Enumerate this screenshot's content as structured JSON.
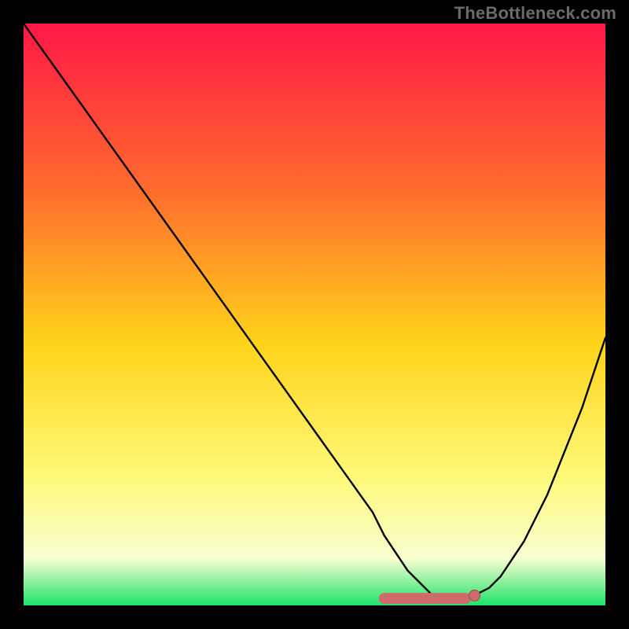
{
  "watermark": "TheBottleneck.com",
  "colors": {
    "gradient_top": "#ff1846",
    "gradient_mid_upper": "#ff6a2e",
    "gradient_mid": "#ffd31a",
    "gradient_lower": "#fff97a",
    "gradient_valley": "#f7ffd0",
    "gradient_bottom": "#1fe26a",
    "curve": "#000000",
    "marker": "#cf6b6a",
    "marker_stroke": "#9c4a49"
  },
  "chart_data": {
    "type": "line",
    "title": "",
    "xlabel": "",
    "ylabel": "",
    "xlim": [
      0,
      100
    ],
    "ylim": [
      0,
      100
    ],
    "grid": false,
    "series": [
      {
        "name": "bottleneck-curve",
        "x": [
          0,
          5,
          10,
          15,
          20,
          25,
          30,
          35,
          40,
          45,
          50,
          55,
          60,
          62,
          64,
          66,
          68,
          70,
          72,
          74,
          76,
          78,
          80,
          82,
          84,
          86,
          88,
          90,
          92,
          94,
          96,
          98,
          100
        ],
        "values": [
          100,
          93,
          86,
          79,
          72,
          65,
          58,
          51,
          44,
          37,
          30,
          23,
          16,
          12,
          9,
          6,
          4,
          2,
          1,
          1,
          1,
          2,
          3,
          5,
          8,
          11,
          15,
          19,
          24,
          29,
          34,
          40,
          46
        ]
      }
    ],
    "markers": [
      {
        "name": "optimal-range",
        "type": "segment",
        "x": [
          62,
          76
        ],
        "y": [
          1.2,
          1.2
        ]
      },
      {
        "name": "optimal-point",
        "type": "dot",
        "x": 77.5,
        "y": 1.7
      }
    ]
  }
}
